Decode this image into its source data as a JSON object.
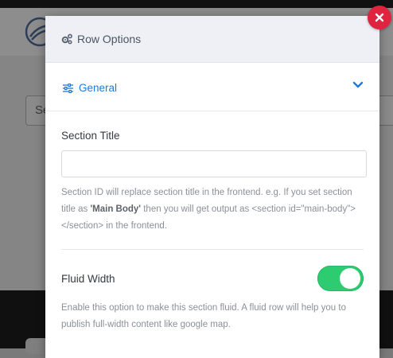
{
  "modal": {
    "title": "Row Options",
    "section": {
      "label": "General",
      "expanded": true
    },
    "section_title": {
      "label": "Section Title",
      "value": "",
      "help_prefix": "Section ID will replace section title in the frontend. e.g. If you set section title as ",
      "help_bold": "'Main Body'",
      "help_suffix": " then you will get output as <section id=\"main-body\"></section> in the frontend."
    },
    "fluid_width": {
      "label": "Fluid Width",
      "enabled": true,
      "help": "Enable this option to make this section fluid. A fluid row will help you to publish full-width content like google map."
    }
  },
  "background": {
    "input_text": "Se"
  },
  "colors": {
    "toggle_on": "#2ecc71",
    "close": "#e0243f",
    "accent": "#1e7ad6"
  },
  "icons": [
    "gears-icon",
    "close-icon",
    "sliders-icon",
    "chevron-down-icon",
    "logo-icon"
  ]
}
